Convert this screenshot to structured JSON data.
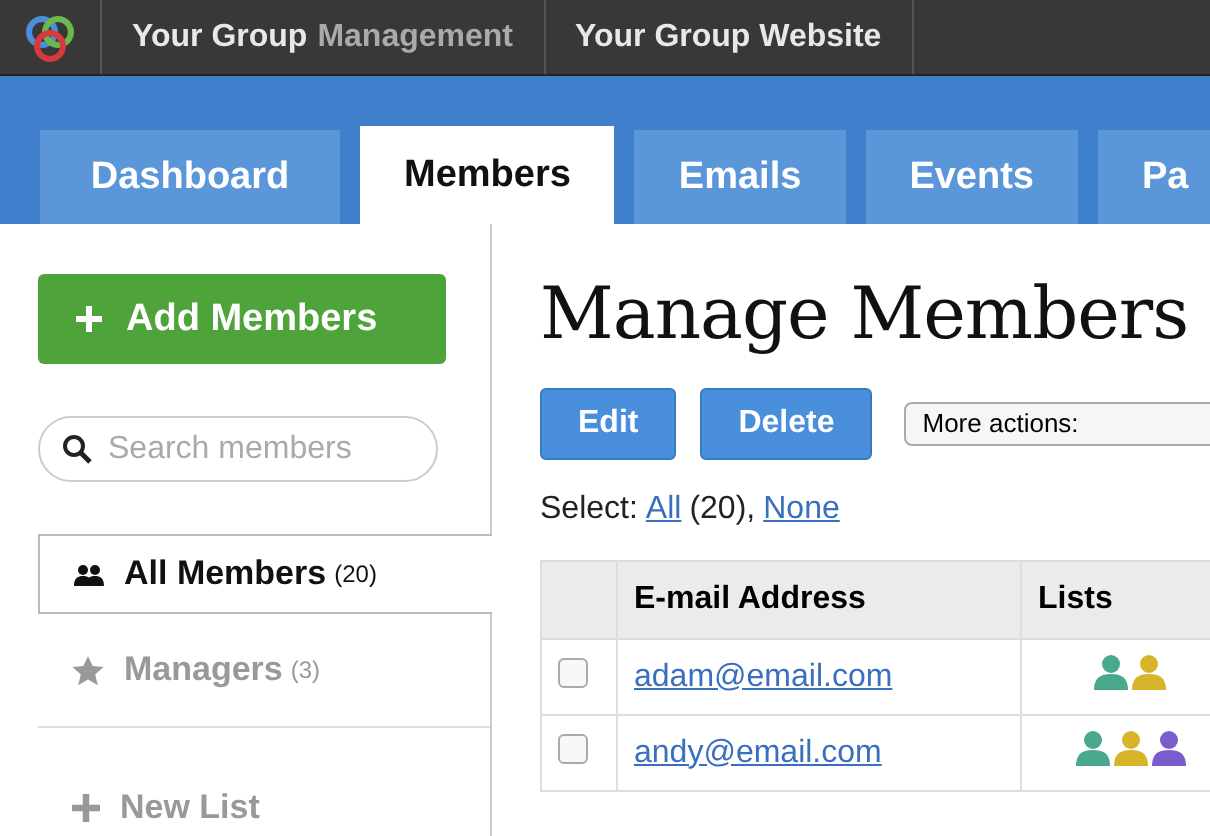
{
  "topbar": {
    "items": [
      {
        "label": "Your Group",
        "suffix": "Management"
      },
      {
        "label": "Your Group Website"
      }
    ]
  },
  "tabs": [
    {
      "label": "Dashboard",
      "selected": false
    },
    {
      "label": "Members",
      "selected": true
    },
    {
      "label": "Emails",
      "selected": false
    },
    {
      "label": "Events",
      "selected": false
    },
    {
      "label": "Pa",
      "selected": false
    }
  ],
  "sidebar": {
    "add_button": "Add Members",
    "search": {
      "placeholder": "Search members"
    },
    "items": [
      {
        "kind": "all",
        "label": "All Members",
        "count": "(20)",
        "selected": true
      },
      {
        "kind": "managers",
        "label": "Managers",
        "count": "(3)",
        "selected": false
      },
      {
        "kind": "new",
        "label": "New List",
        "selected": false
      }
    ]
  },
  "main": {
    "title": "Manage Members",
    "buttons": [
      "Edit",
      "Delete"
    ],
    "actions_select": "More actions:",
    "select_label": "Select:",
    "select_all": "All",
    "select_all_count": "(20),",
    "select_none": "None",
    "table": {
      "columns": [
        "E-mail Address",
        "Lists"
      ],
      "rows": [
        {
          "checked": false,
          "email": "adam@email.com",
          "lists": [
            {
              "color": "#4aa88f"
            },
            {
              "color": "#d8b42a"
            }
          ]
        },
        {
          "checked": false,
          "email": "andy@email.com",
          "lists": [
            {
              "color": "#4aa88f"
            },
            {
              "color": "#d8b42a"
            },
            {
              "color": "#7a5ccc"
            }
          ]
        }
      ]
    }
  }
}
